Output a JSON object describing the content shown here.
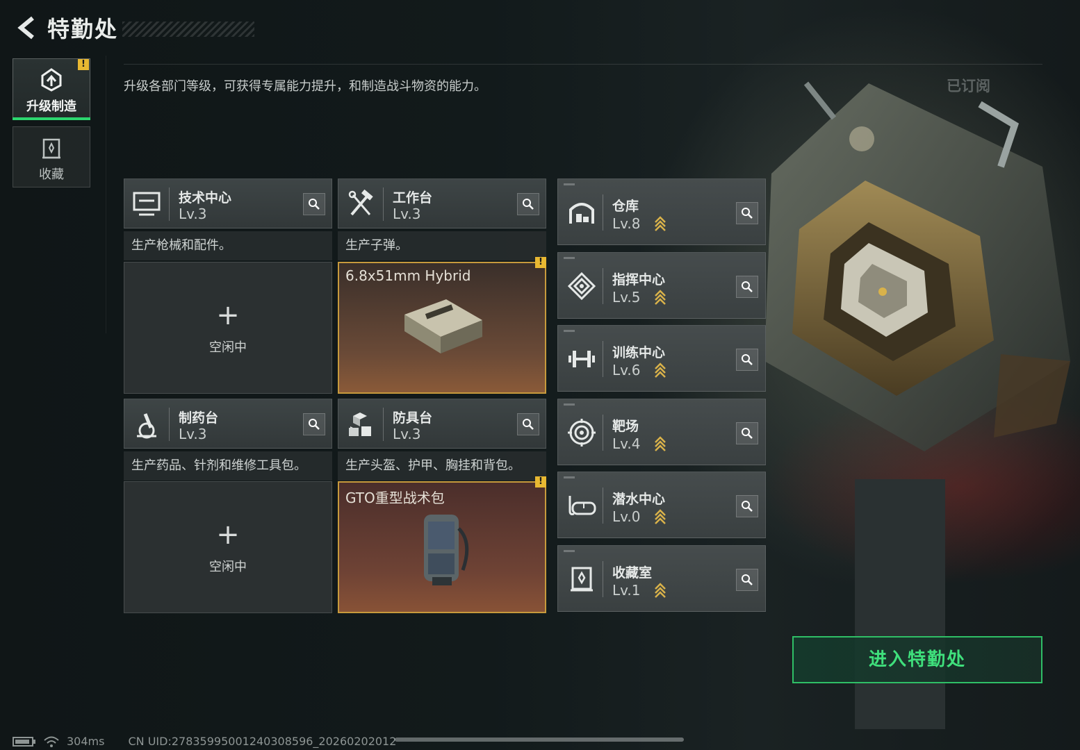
{
  "header": {
    "title": "特勤处"
  },
  "nav": [
    {
      "label": "升级制造",
      "warning": "!"
    },
    {
      "label": "收藏"
    }
  ],
  "description": "升级各部门等级，可获得专属能力提升，和制造战斗物资的能力。",
  "subscribed_label": "已订阅",
  "workstations": [
    {
      "name": "技术中心",
      "level": "Lv.3",
      "subtitle": "生产枪械和配件。",
      "slot_plus": "+",
      "slot_status": "空闲中"
    },
    {
      "name": "工作台",
      "level": "Lv.3",
      "subtitle": "生产子弹。",
      "slot_item": "6.8x51mm Hybrid",
      "warning": "!"
    },
    {
      "name": "制药台",
      "level": "Lv.3",
      "subtitle": "生产药品、针剂和维修工具包。",
      "slot_plus": "+",
      "slot_status": "空闲中"
    },
    {
      "name": "防具台",
      "level": "Lv.3",
      "subtitle": "生产头盔、护甲、胸挂和背包。",
      "slot_item": "GTO重型战术包",
      "warning": "!"
    }
  ],
  "facilities": [
    {
      "name": "仓库",
      "level": "Lv.8",
      "icon": "warehouse-icon"
    },
    {
      "name": "指挥中心",
      "level": "Lv.5",
      "icon": "command-icon"
    },
    {
      "name": "训练中心",
      "level": "Lv.6",
      "icon": "dumbbell-icon"
    },
    {
      "name": "靶场",
      "level": "Lv.4",
      "icon": "target-icon"
    },
    {
      "name": "潜水中心",
      "level": "Lv.0",
      "icon": "diving-mask-icon"
    },
    {
      "name": "收藏室",
      "level": "Lv.1",
      "icon": "collection-icon"
    }
  ],
  "enter_button": "进入特勤处",
  "footer": {
    "ping": "304ms",
    "uid": "CN UID:27835995001240308596_20260202012"
  },
  "colors": {
    "accent_green": "#2cd66e",
    "warning_yellow": "#e8b832",
    "upgrade_gold": "#d9b24a"
  }
}
